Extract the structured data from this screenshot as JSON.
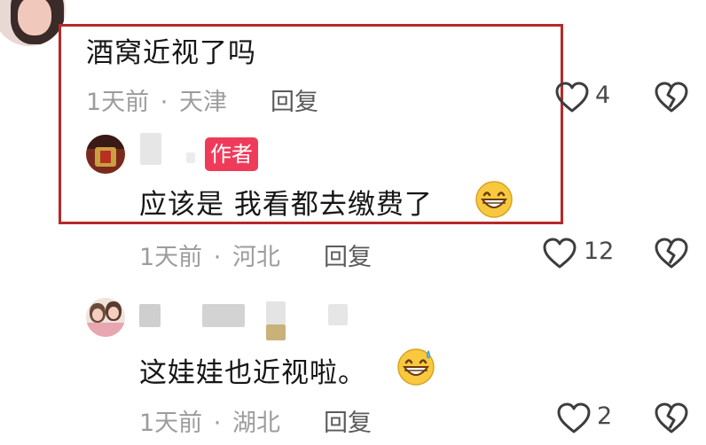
{
  "comments": [
    {
      "text": "酒窝近视了吗",
      "time": "1天前",
      "separator": "·",
      "location": "天津",
      "reply_label": "回复",
      "like_count": "4"
    }
  ],
  "replies": [
    {
      "badge": "作者",
      "text": "应该是  我看都去缴费了",
      "emoji": "grinning-emoji",
      "time": "1天前",
      "separator": "·",
      "location": "河北",
      "reply_label": "回复",
      "like_count": "12"
    },
    {
      "text": "这娃娃也近视啦。",
      "emoji": "grinning-sweat-emoji",
      "time": "1天前",
      "separator": "·",
      "location": "湖北",
      "reply_label": "回复",
      "like_count": "2"
    }
  ],
  "colors": {
    "highlight_border": "#b52a2a",
    "author_badge": "#ef3b5a",
    "meta_text": "#9c9c9c"
  },
  "icons": [
    "heart-outline-icon",
    "broken-heart-icon"
  ]
}
